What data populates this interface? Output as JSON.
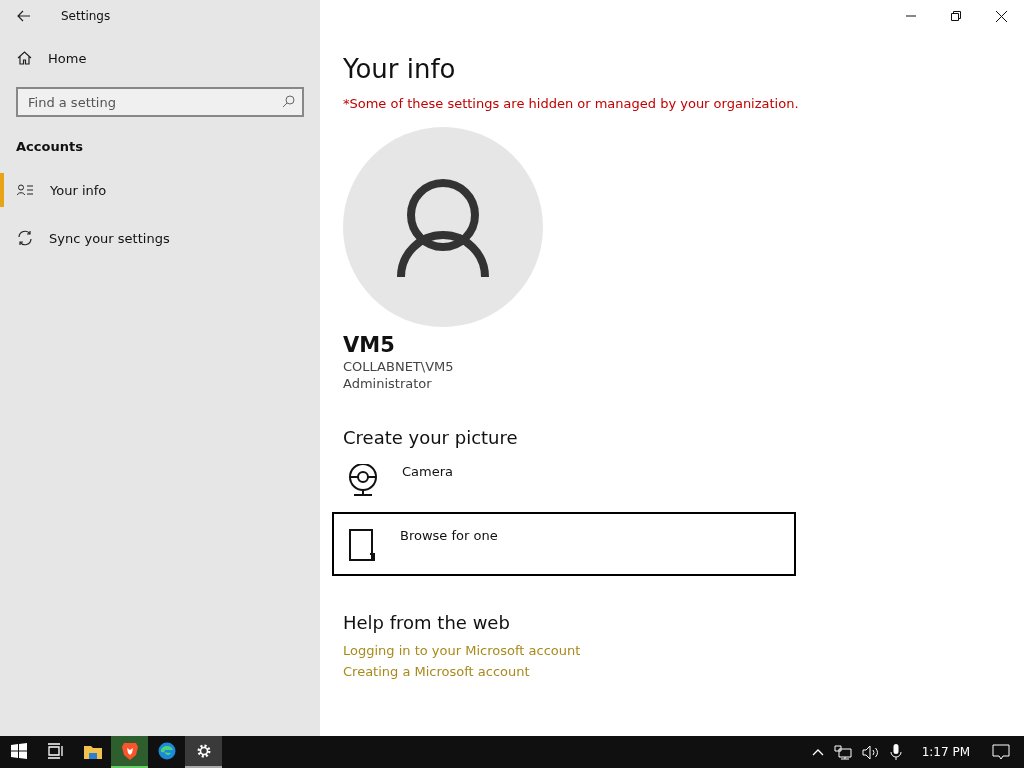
{
  "window": {
    "title": "Settings"
  },
  "sidebar": {
    "home": "Home",
    "search": {
      "placeholder": "Find a setting"
    },
    "section": "Accounts",
    "items": [
      {
        "label": "Your info",
        "kind": "person-list",
        "selected": true
      },
      {
        "label": "Sync your settings",
        "kind": "sync",
        "selected": false
      }
    ]
  },
  "main": {
    "title": "Your info",
    "notice": "*Some of these settings are hidden or managed by your organization.",
    "user": {
      "name": "VM5",
      "account": "COLLABNET\\VM5",
      "role": "Administrator"
    },
    "create_heading": "Create your picture",
    "options": [
      {
        "kind": "camera",
        "label": "Camera",
        "selected": false
      },
      {
        "kind": "browse",
        "label": "Browse for one",
        "selected": true
      }
    ],
    "help_heading": "Help from the web",
    "links": [
      "Logging in to your Microsoft account",
      "Creating a Microsoft account"
    ]
  },
  "taskbar": {
    "apps": [
      {
        "kind": "start",
        "active": false
      },
      {
        "kind": "taskview",
        "active": false
      },
      {
        "kind": "explorer",
        "active": false
      },
      {
        "kind": "brave",
        "active": true
      },
      {
        "kind": "edge",
        "active": false
      },
      {
        "kind": "settings",
        "active": true
      }
    ],
    "time": "1:17 PM"
  }
}
